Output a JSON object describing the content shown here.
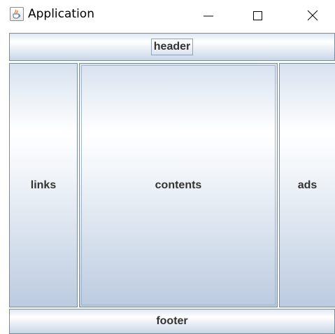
{
  "window": {
    "title": "Application",
    "icon": "java-cup-icon"
  },
  "controls": {
    "minimize_icon": "minimize-icon",
    "maximize_icon": "maximize-icon",
    "close_icon": "close-icon"
  },
  "layout": {
    "header_label": "header",
    "links_label": "links",
    "contents_label": "contents",
    "ads_label": "ads",
    "footer_label": "footer"
  },
  "colors": {
    "button_gradient_top": "#dde8f3",
    "button_gradient_mid": "#ffffff",
    "button_gradient_bottom": "#c9d6e6",
    "button_border": "#7a8a99",
    "label_text": "#333333"
  }
}
